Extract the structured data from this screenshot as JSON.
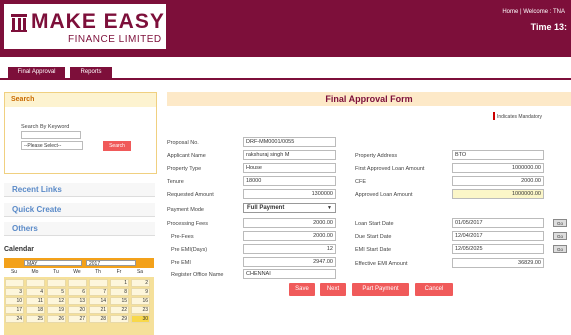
{
  "brand": {
    "name": "MAKE EASY",
    "sub": "FINANCE LIMITED"
  },
  "header": {
    "links": "Home | Welcome : TNA",
    "time": "Time 13:"
  },
  "tabs": [
    "Final Approval",
    "Reports"
  ],
  "sidebar": {
    "search_title": "Search",
    "search_by_label": "Search By Keyword",
    "search_input": "",
    "select_value": "--Please Select--",
    "search_button": "Search",
    "links": [
      "Recent Links",
      "Quick Create",
      "Others"
    ],
    "calendar_title": "Calendar",
    "calendar": {
      "month": "MAY",
      "year": "2017",
      "days": [
        "Su",
        "Mo",
        "Tu",
        "We",
        "Th",
        "Fr",
        "Sa"
      ],
      "rows": [
        [
          "",
          "",
          "",
          "",
          "",
          "1",
          "2"
        ],
        [
          "3",
          "4",
          "5",
          "6",
          "7",
          "8",
          "9"
        ],
        [
          "10",
          "11",
          "12",
          "13",
          "14",
          "15",
          "16"
        ],
        [
          "17",
          "18",
          "19",
          "20",
          "21",
          "22",
          "23"
        ],
        [
          "24",
          "25",
          "26",
          "27",
          "28",
          "29",
          "30"
        ]
      ],
      "highlight": "30"
    }
  },
  "form": {
    "title": "Final Approval Form",
    "mandatory_note": "Indicates Mandatory",
    "left_fields": [
      {
        "label": "Proposal No.",
        "value": "DRF-MM0001/0055",
        "align": "left"
      },
      {
        "label": "Applicant Name",
        "value": "rakshuraj singh M",
        "align": "left"
      },
      {
        "label": "Property Type",
        "value": "House",
        "align": "left"
      },
      {
        "label": "Tenure",
        "value": "18000",
        "align": "left"
      },
      {
        "label": "Requested Amount",
        "value": "1300000",
        "align": "right"
      }
    ],
    "right_fields": [
      {
        "label": "Property Address",
        "value": "BTO",
        "align": "left",
        "yellow": false
      },
      {
        "label": "First Approved Loan Amount",
        "value": "1000000.00",
        "align": "right",
        "yellow": false
      },
      {
        "label": "CFE",
        "value": "2000.00",
        "align": "right",
        "yellow": false
      },
      {
        "label": "Approved Loan Amount",
        "value": "1000000.00",
        "align": "right",
        "yellow": true
      }
    ],
    "payment_mode_label": "Payment Mode",
    "payment_mode_value": "Full Payment",
    "fee_fields": [
      {
        "label": "Processing Fees",
        "value": "2000.00"
      },
      {
        "label": "Pre-Fees",
        "value": "2000.00"
      },
      {
        "label": "Pre EMI(Days)",
        "value": "12"
      },
      {
        "label": "Pre EMI",
        "value": "2947.00"
      }
    ],
    "date_fields": [
      {
        "label": "Loan Start Date",
        "value": "01/05/2017"
      },
      {
        "label": "Due Start Date",
        "value": "12/04/2017"
      },
      {
        "label": "EMI Start Date",
        "value": "12/05/2025"
      }
    ],
    "emi_label": "Effective EMI Amount",
    "emi_value": "36829.00",
    "office_label": "Register Office Name",
    "office_value": "CHENNAI",
    "go_label": "Go",
    "buttons": [
      "Save",
      "Next",
      "Part Payment",
      "Cancel"
    ]
  }
}
